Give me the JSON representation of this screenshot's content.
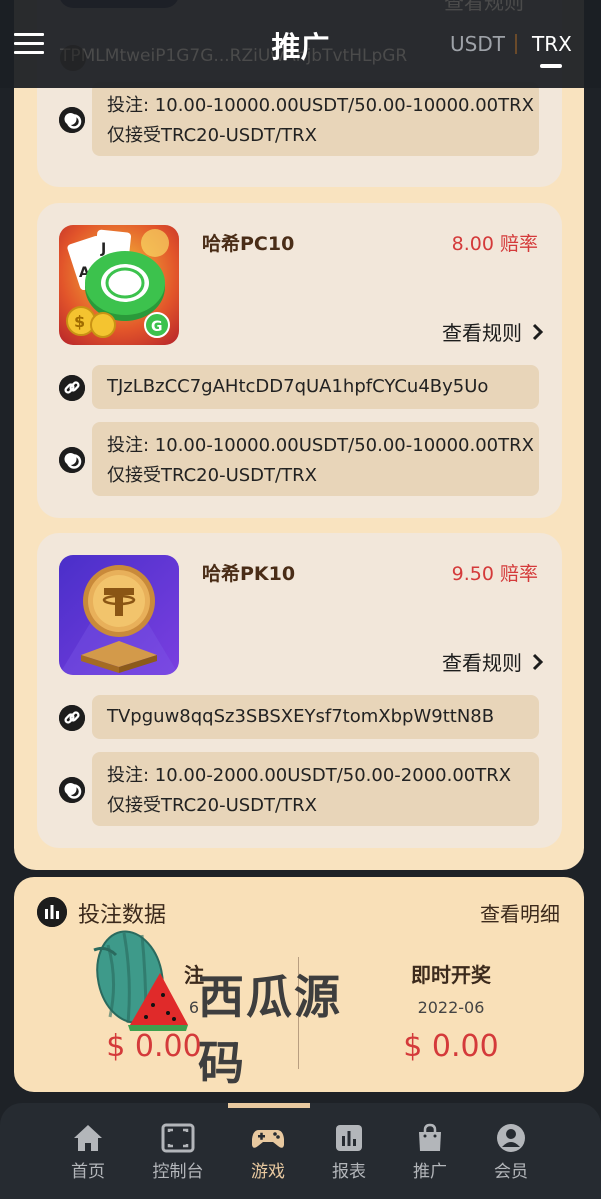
{
  "header": {
    "title": "推广",
    "currency_usdt": "USDT",
    "currency_trx": "TRX",
    "active_currency": "TRX",
    "partial_address": "TPMLMtweiP1G7G...RZiUwAnjbTvtHLpGR",
    "partial_link": "查看规则"
  },
  "cards": [
    {
      "name": "",
      "odds": "",
      "rules_label": "",
      "address": "",
      "limit_line1": "投注: 10.00-10000.00USDT/50.00-10000.00TRX",
      "limit_line2": "仅接受TRC20-USDT/TRX"
    },
    {
      "name": "哈希PC10",
      "odds": "8.00 赔率",
      "rules_label": "查看规则",
      "address": "TJzLBzCC7gAHtcDD7qUA1hpfCYCu4By5Uo",
      "limit_line1": "投注: 10.00-10000.00USDT/50.00-10000.00TRX",
      "limit_line2": "仅接受TRC20-USDT/TRX",
      "icon": "poker-chip-icon"
    },
    {
      "name": "哈希PK10",
      "odds": "9.50 赔率",
      "rules_label": "查看规则",
      "address": "TVpguw8qqSz3SBSXEYsf7tomXbpW9ttN8B",
      "limit_line1": "投注: 10.00-2000.00USDT/50.00-2000.00TRX",
      "limit_line2": "仅接受TRC20-USDT/TRX",
      "icon": "tether-coin-icon"
    }
  ],
  "bet_data": {
    "title": "投注数据",
    "detail_link": "查看明细",
    "left": {
      "label": "注",
      "date": "6",
      "value": "$ 0.00"
    },
    "right": {
      "label": "即时开奖",
      "date": "2022-06",
      "value": "$ 0.00"
    }
  },
  "watermark": {
    "text": "西瓜源码"
  },
  "nav": [
    {
      "label": "首页",
      "icon": "home-icon"
    },
    {
      "label": "控制台",
      "icon": "console-icon"
    },
    {
      "label": "游戏",
      "icon": "gamepad-icon",
      "active": true
    },
    {
      "label": "报表",
      "icon": "report-icon"
    },
    {
      "label": "推广",
      "icon": "shopping-bag-icon"
    },
    {
      "label": "会员",
      "icon": "user-icon"
    }
  ],
  "colors": {
    "panel": "#f9e3bf",
    "card": "#f2e7da",
    "row_box": "#e8d5b9",
    "odds_red": "#d43a3a",
    "header_bg": "#1c1f24",
    "nav_bg": "#262b31",
    "nav_active": "#e8c9a0"
  }
}
